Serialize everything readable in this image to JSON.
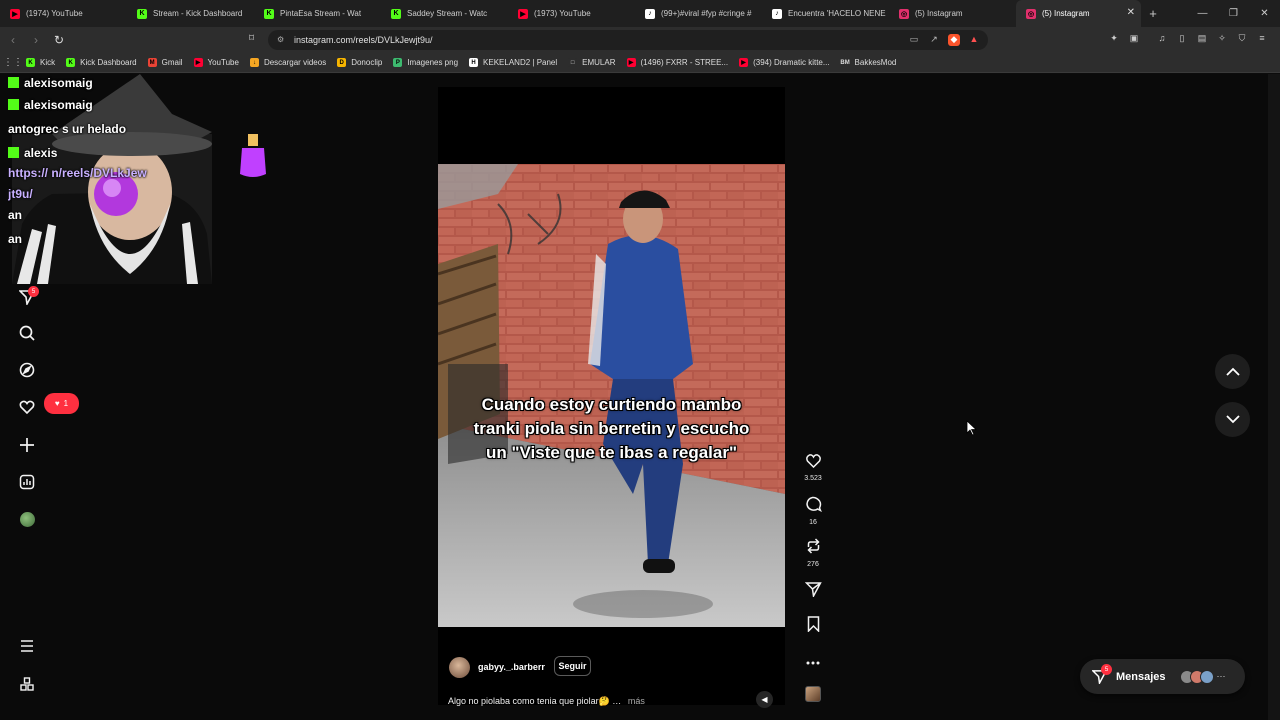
{
  "browser": {
    "tabs": [
      {
        "label": "(1974) YouTube",
        "icon": "youtube-icon",
        "color": "#ff0033",
        "glyph": "▶"
      },
      {
        "label": "Stream - Kick Dashboard",
        "icon": "kick-icon",
        "color": "#53fc18",
        "glyph": "K"
      },
      {
        "label": "PintaEsa Stream - Wat",
        "icon": "kick-icon",
        "color": "#53fc18",
        "glyph": "K"
      },
      {
        "label": "Saddey Stream - Watc",
        "icon": "kick-icon",
        "color": "#53fc18",
        "glyph": "K"
      },
      {
        "label": "(1973) YouTube",
        "icon": "youtube-icon",
        "color": "#ff0033",
        "glyph": "▶"
      },
      {
        "label": "(99+)#viral #fyp #cringe #",
        "icon": "tiktok-icon",
        "color": "#ffffff",
        "glyph": "♪"
      },
      {
        "label": "Encuentra 'HACELO NENE",
        "icon": "tiktok-icon",
        "color": "#ffffff",
        "glyph": "♪"
      },
      {
        "label": "(5) Instagram",
        "icon": "instagram-icon",
        "color": "#e1306c",
        "glyph": "◎"
      },
      {
        "label": "(5) Instagram",
        "icon": "instagram-icon",
        "color": "#e1306c",
        "glyph": "◎",
        "active": true
      }
    ],
    "url": "instagram.com/reels/DVLkJewjt9u/",
    "bookmarks": [
      {
        "label": "Kick",
        "color": "#53fc18",
        "glyph": "K"
      },
      {
        "label": "Kick Dashboard",
        "color": "#53fc18",
        "glyph": "K"
      },
      {
        "label": "Gmail",
        "color": "#ea4335",
        "glyph": "M"
      },
      {
        "label": "YouTube",
        "color": "#ff0033",
        "glyph": "▶"
      },
      {
        "label": "Descargar videos",
        "color": "#f5a623",
        "glyph": "↓"
      },
      {
        "label": "Donoclip",
        "color": "#f7b500",
        "glyph": "D"
      },
      {
        "label": "Imagenes png",
        "color": "#3dba6f",
        "glyph": "P"
      },
      {
        "label": "KEKELAND2 | Panel",
        "color": "#ffffff",
        "glyph": "H"
      },
      {
        "label": "EMULAR",
        "color": "#2d2d2d",
        "glyph": "□"
      },
      {
        "label": "(1496) FXRR - STREE...",
        "color": "#ff0033",
        "glyph": "▶"
      },
      {
        "label": "(394) Dramatic kitte...",
        "color": "#ff0033",
        "glyph": "▶"
      },
      {
        "label": "BakkesMod",
        "color": "#2d2d2d",
        "glyph": "BM"
      }
    ]
  },
  "overlay": {
    "chat": [
      {
        "text": "alexisomaig",
        "kick": true
      },
      {
        "text": "alexisomaig",
        "kick": true
      },
      {
        "text": "antogrec                    s ur helado",
        "kick": false
      },
      {
        "text": "alexis",
        "kick": true
      },
      {
        "text": "https://            n/reels/DVLkJew",
        "kick": false,
        "purple": true
      },
      {
        "text": "jt9u/",
        "kick": false,
        "purple": true
      },
      {
        "text": "an",
        "kick": false
      },
      {
        "text": "an",
        "kick": false
      }
    ]
  },
  "sidebar": {
    "notifications_count": "5",
    "likes_count": "1"
  },
  "reel": {
    "caption_overlay": "Cuando estoy curtiendo mambo tranki piola sin berretin y escucho un \"Viste que te ibas a regalar\"",
    "username": "gabyy._.barberr",
    "follow_label": "Seguir",
    "description": "Algo no piolaba como tenia que piolar🤔 …",
    "more_label": "más",
    "likes": "3.523",
    "comments": "16",
    "reposts": "276"
  },
  "messages": {
    "label": "Mensajes",
    "badge": "5"
  },
  "colors": {
    "notification_red": "#ff3040",
    "kick_green": "#53fc18",
    "instagram_bg": "#0a0a0a"
  }
}
